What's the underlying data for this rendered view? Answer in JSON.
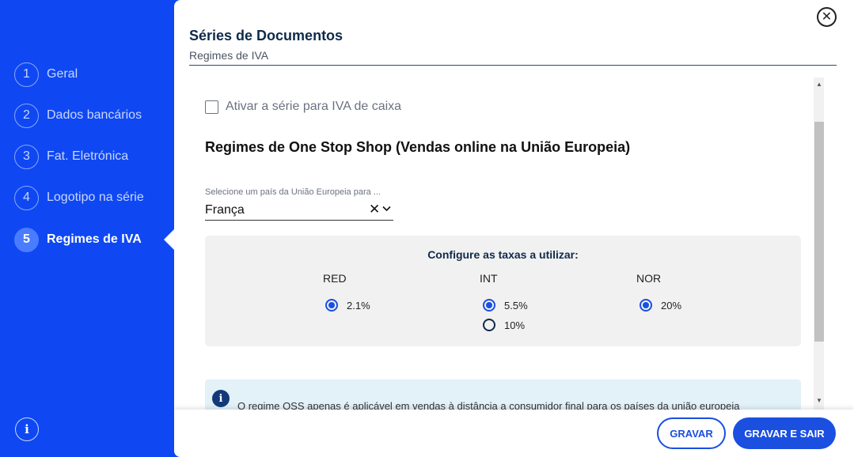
{
  "sidebar": {
    "steps": [
      {
        "number": "1",
        "label": "Geral"
      },
      {
        "number": "2",
        "label": "Dados bancários"
      },
      {
        "number": "3",
        "label": "Fat. Eletrónica"
      },
      {
        "number": "4",
        "label": "Logotipo na série"
      },
      {
        "number": "5",
        "label": "Regimes de IVA"
      }
    ],
    "active_step": 5,
    "info_icon": "info-icon"
  },
  "header": {
    "title": "Séries de Documentos",
    "subtitle": "Regimes de IVA",
    "close_icon": "close-icon"
  },
  "content": {
    "cash_vat_checkbox_label": "Ativar a série para IVA de caixa",
    "cash_vat_checked": false,
    "oss_title": "Regimes de One Stop Shop (Vendas online na União Europeia)",
    "country_select": {
      "label": "Selecione um país da União Europeia para ...",
      "value": "França"
    },
    "rates": {
      "title": "Configure as taxas a utilizar:",
      "columns": [
        {
          "name": "RED",
          "options": [
            {
              "label": "2.1%",
              "selected": true
            }
          ]
        },
        {
          "name": "INT",
          "options": [
            {
              "label": "5.5%",
              "selected": true
            },
            {
              "label": "10%",
              "selected": false
            }
          ]
        },
        {
          "name": "NOR",
          "options": [
            {
              "label": "20%",
              "selected": true
            }
          ]
        }
      ]
    },
    "note": {
      "text": "O regime OSS apenas é aplicável em vendas à distância a consumidor final para os países da união europeia"
    }
  },
  "footer": {
    "save_label": "GRAVAR",
    "save_exit_label": "GRAVAR E SAIR"
  },
  "colors": {
    "sidebar_bg": "#0f48f2",
    "accent": "#1a4fe0",
    "title_dark": "#0f2a4a"
  }
}
